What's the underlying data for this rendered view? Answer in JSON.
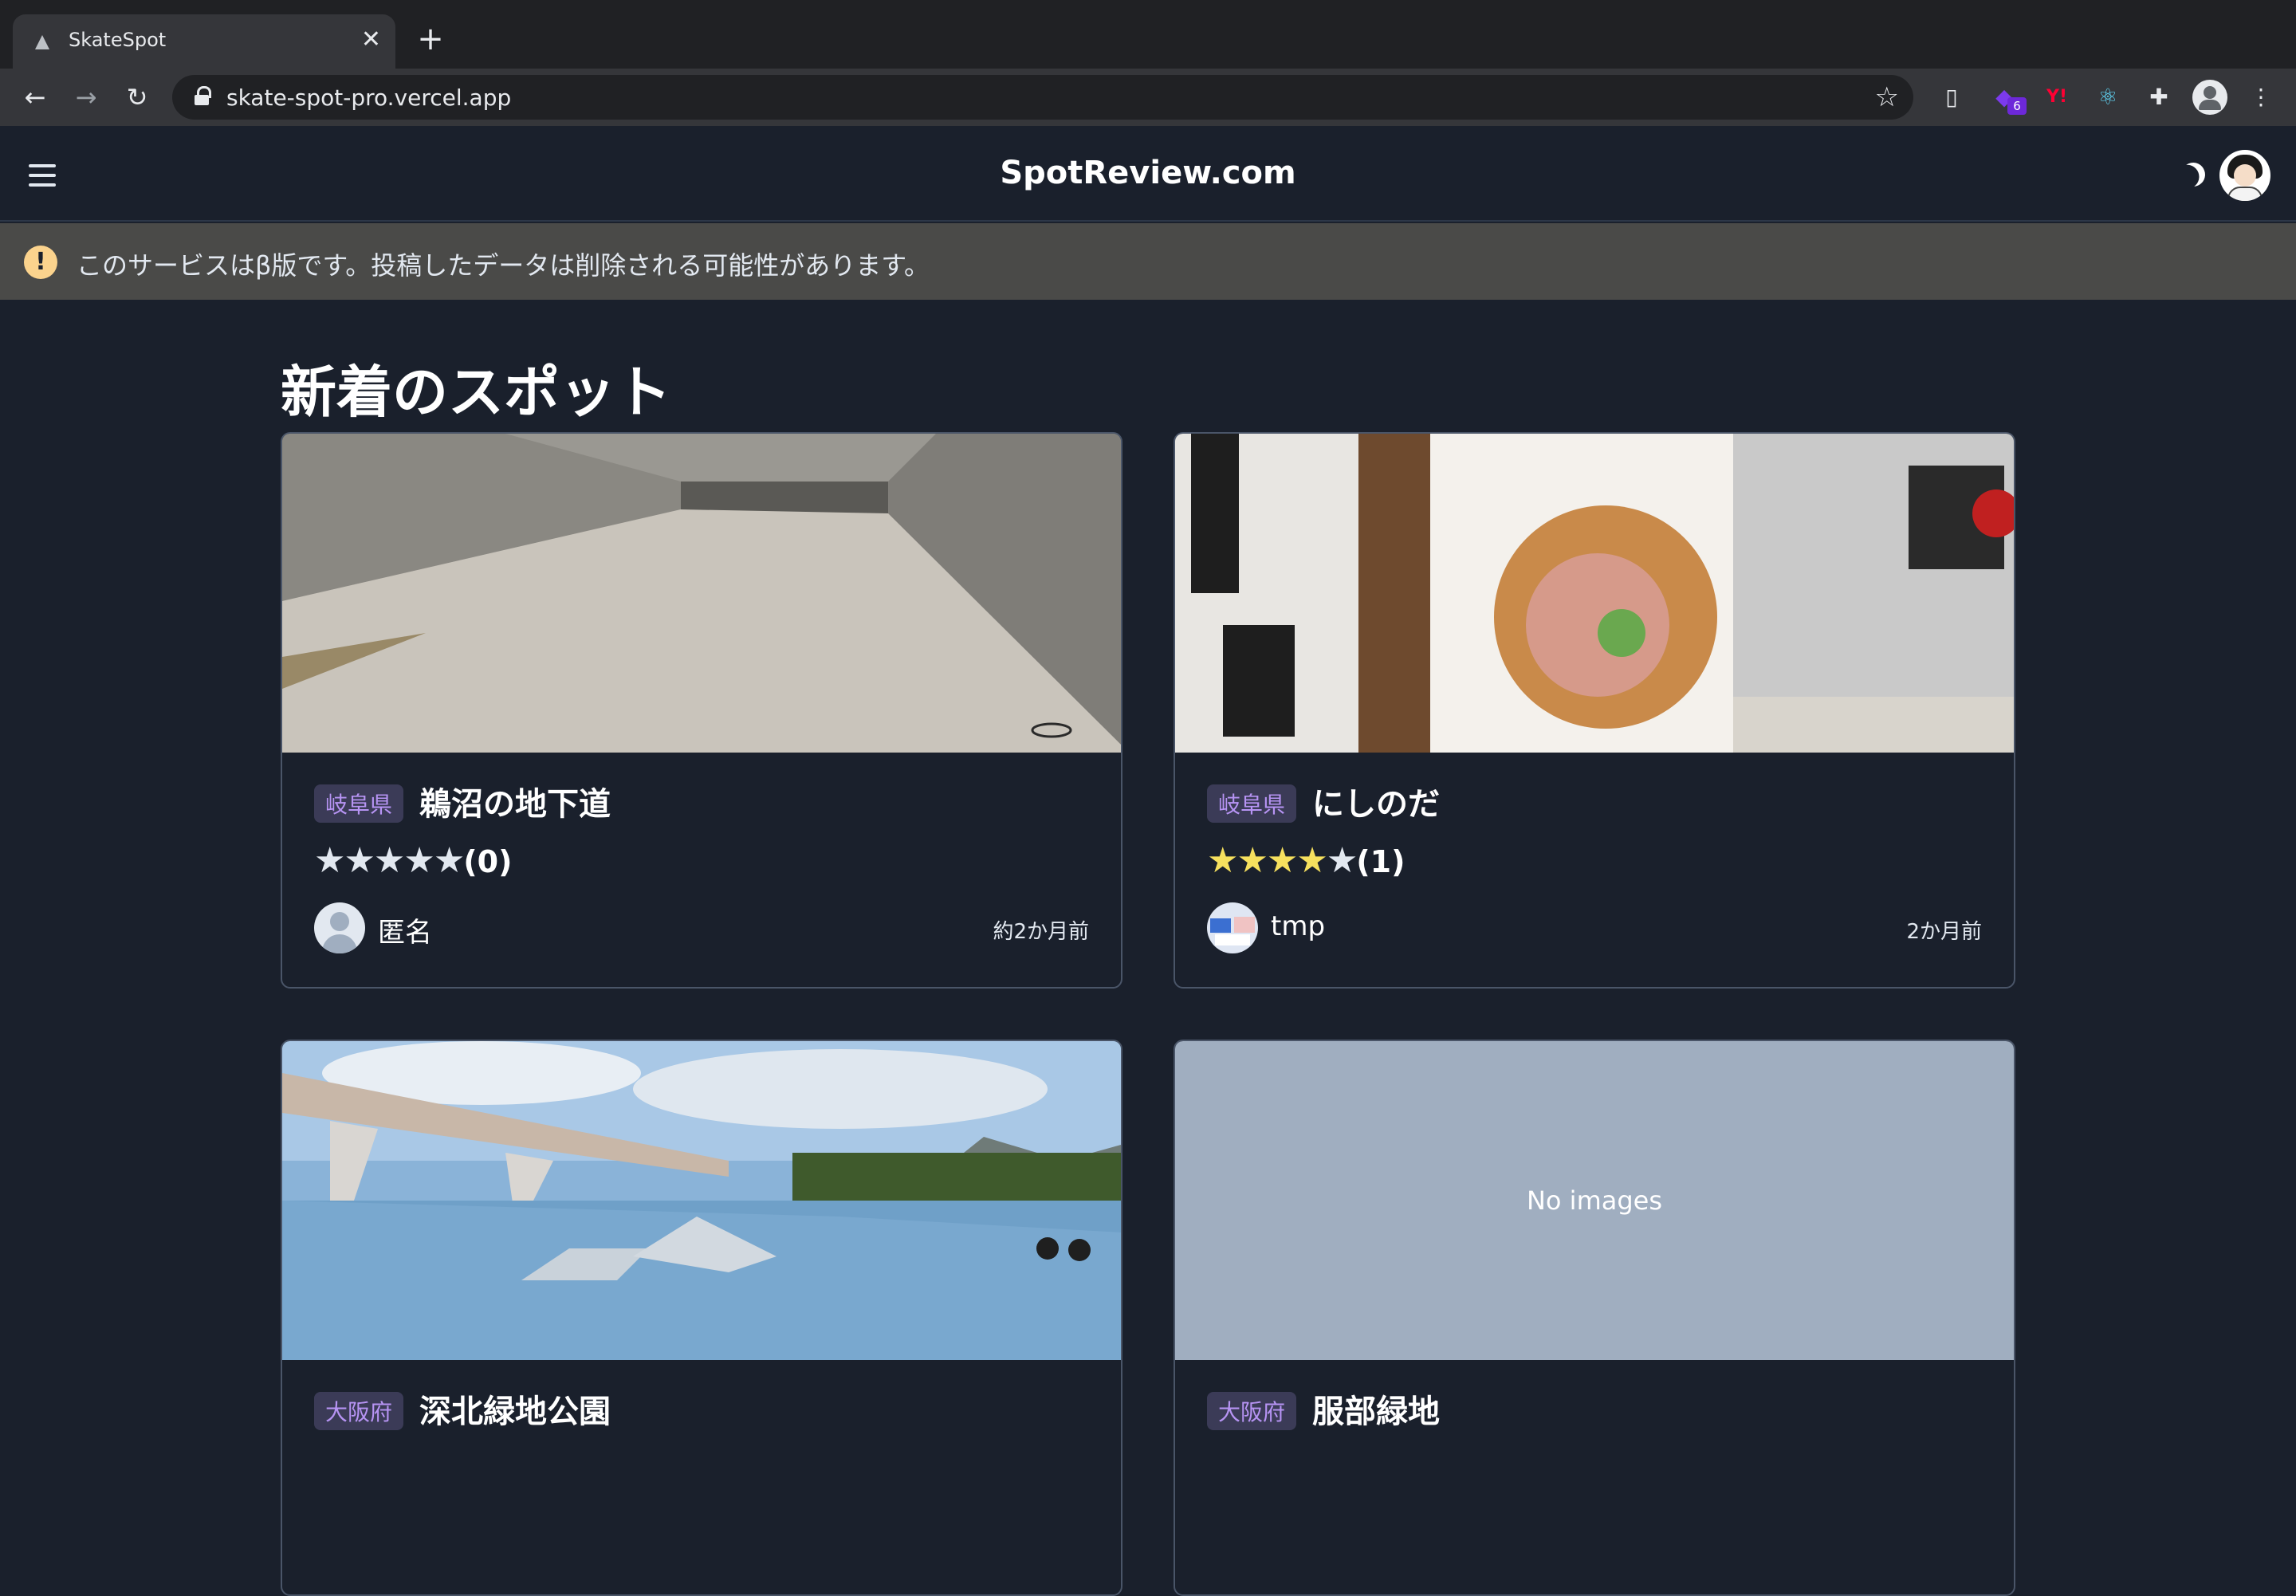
{
  "browser": {
    "tab_title": "SkateSpot",
    "url": "skate-spot-pro.vercel.app",
    "extension_badge": "6",
    "yahoo_ext": "Y!"
  },
  "header": {
    "brand": "SpotReview.com"
  },
  "alert": {
    "text": "このサービスはβ版です。投稿したデータは削除される可能性があります。"
  },
  "section": {
    "title": "新着のスポット"
  },
  "spots": [
    {
      "prefecture": "岐阜県",
      "name": "鵜沼の地下道",
      "rating": 0,
      "review_count": "(0)",
      "user": "匿名",
      "time": "約2か月前",
      "has_image": true
    },
    {
      "prefecture": "岐阜県",
      "name": "にしのだ",
      "rating": 4,
      "review_count": "(1)",
      "user": "tmp",
      "time": "2か月前",
      "has_image": true
    },
    {
      "prefecture": "大阪府",
      "name": "深北緑地公園",
      "has_image": true
    },
    {
      "prefecture": "大阪府",
      "name": "服部緑地",
      "has_image": false,
      "no_image_text": "No images"
    }
  ]
}
